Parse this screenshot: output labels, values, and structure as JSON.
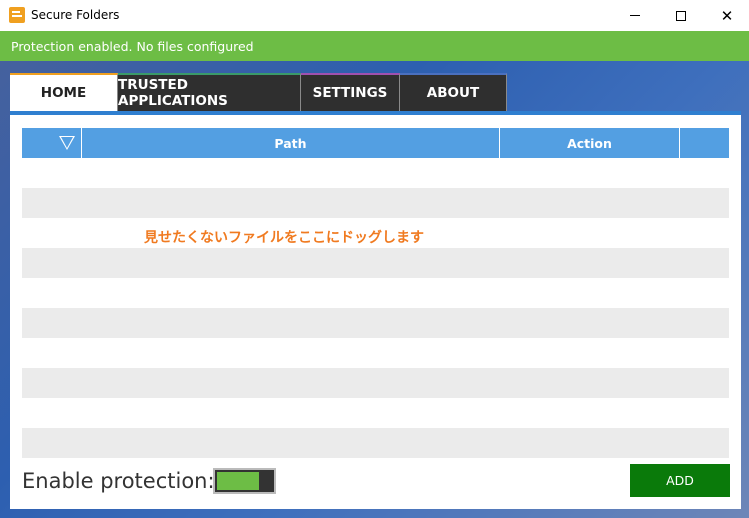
{
  "window": {
    "title": "Secure Folders",
    "minimize_icon": "minimize-icon",
    "maximize_icon": "maximize-icon",
    "close_icon": "close-icon",
    "close_glyph": "✕"
  },
  "status": {
    "text": "Protection enabled. No files configured",
    "color": "#6dbd45"
  },
  "tabs": [
    {
      "label": "HOME",
      "active": true
    },
    {
      "label": "TRUSTED APPLICATIONS",
      "active": false
    },
    {
      "label": "SETTINGS",
      "active": false
    },
    {
      "label": "ABOUT",
      "active": false
    }
  ],
  "table": {
    "columns": [
      "",
      "Path",
      "Action",
      ""
    ],
    "filter_icon": "filter-icon",
    "rows": []
  },
  "drop_hint": "見せたくないファイルをここにドッグします",
  "footer": {
    "enable_label": "Enable protection:",
    "toggle_on": true,
    "add_label": "ADD"
  },
  "colors": {
    "accent_blue": "#539fe2",
    "add_green": "#0a7a0a",
    "hint_orange": "#f07a20"
  }
}
